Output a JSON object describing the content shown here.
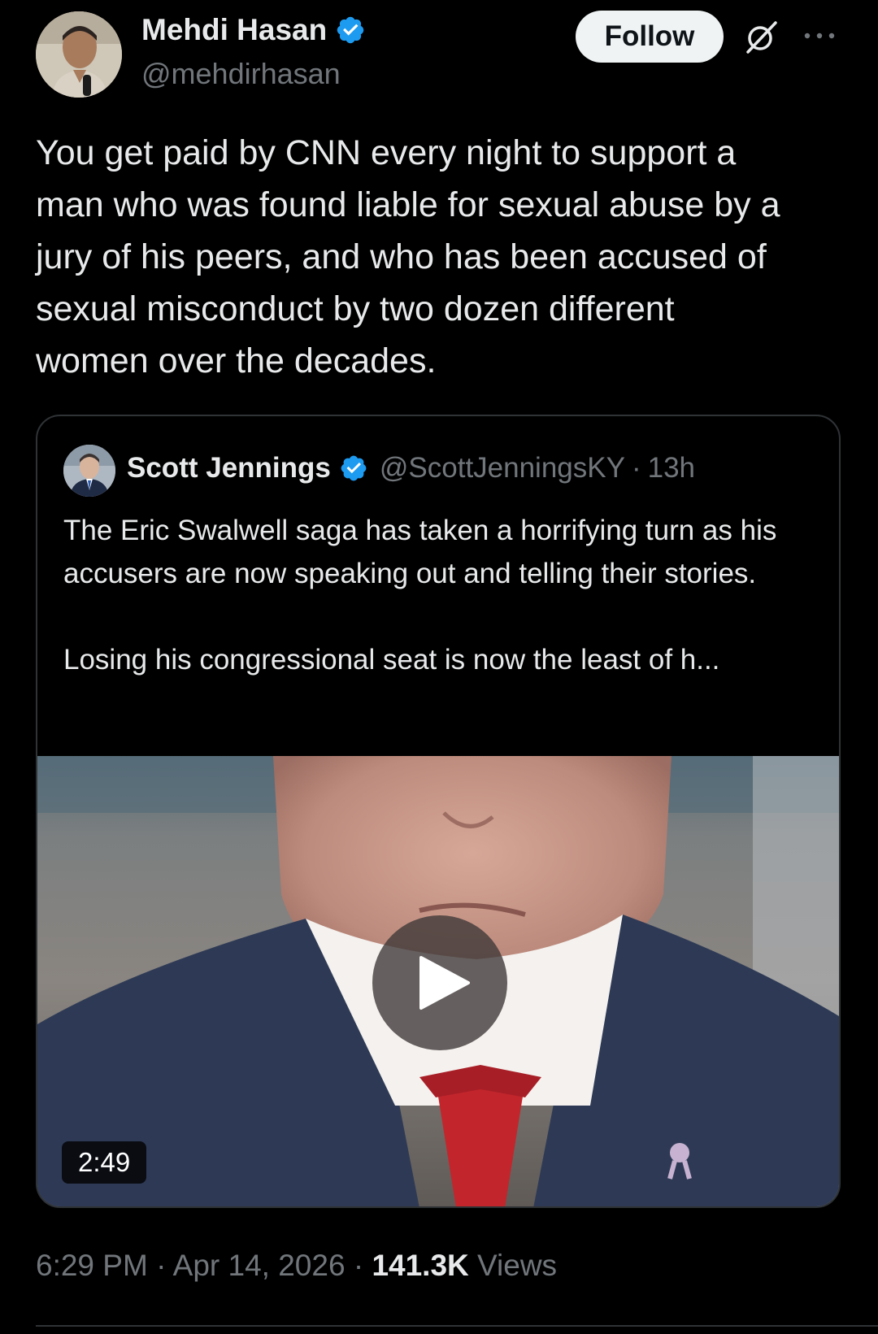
{
  "tweet": {
    "author": {
      "name": "Mehdi Hasan",
      "handle": "@mehdirhasan",
      "verified": true,
      "avatar_icon": "profile-photo"
    },
    "follow_label": "Follow",
    "grok_icon": "grok-icon",
    "more_icon": "more-options-icon",
    "text": "You get paid by CNN every night to support a\nman who was found liable for sexual abuse by a\njury of his peers, and who has been accused of\nsexual misconduct by two dozen different\nwomen over the decades.",
    "quote": {
      "name": "Scott Jennings",
      "handle": "@ScottJenningsKY",
      "separator": "·",
      "time": "13h",
      "verified": true,
      "text_p1": "The Eric Swalwell saga has taken a horrifying turn as his accusers are now speaking out and telling their stories.",
      "text_p2": "Losing his congressional seat is now the least of h...",
      "video": {
        "duration": "2:49",
        "play_icon": "play-icon"
      }
    },
    "meta": {
      "time": "6:29 PM",
      "sep1": "·",
      "date": "Apr 14, 2026",
      "sep2": "·",
      "views_count": "141.3K",
      "views_label": "Views"
    },
    "colors": {
      "background": "#000000",
      "text": "#e7e9ea",
      "secondary": "#71767b",
      "verified": "#1d9bf0",
      "border": "#2f3336"
    }
  }
}
